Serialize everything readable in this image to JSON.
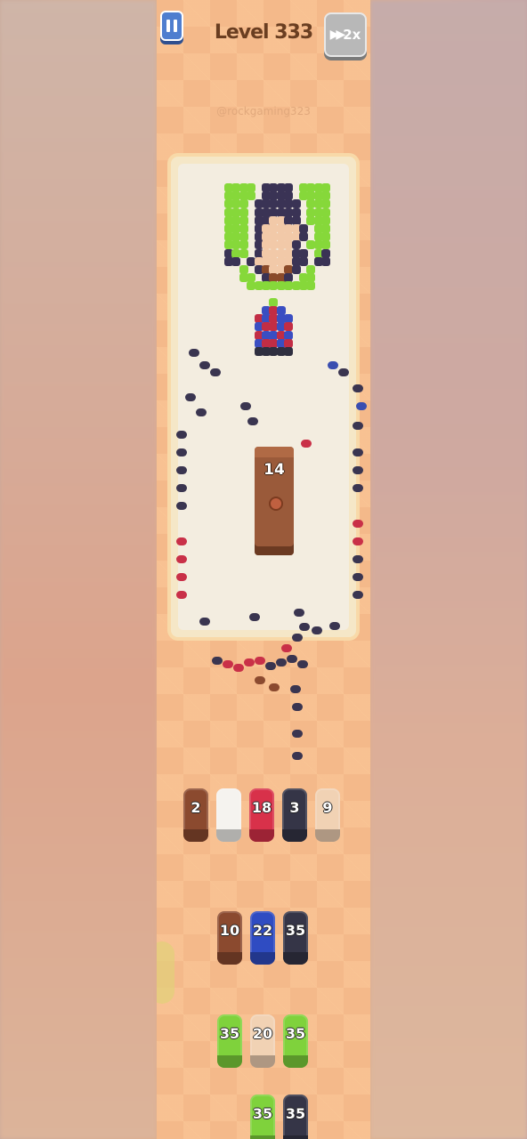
{
  "header": {
    "level": "Level 333",
    "speed": "2x"
  },
  "watermark": "@rockgaming323",
  "board": {
    "crate_count": "14"
  },
  "colors": {
    "brown": "#8b4a2f",
    "white": "#f5f3ef",
    "red": "#d8314a",
    "navy": "#353547",
    "peach": "#f1d2b4",
    "blue": "#2f4cc2",
    "green": "#7fd23c",
    "board": "#f3ede0"
  },
  "tray": [
    {
      "value": "2",
      "color": "brown"
    },
    {
      "value": "",
      "color": "white"
    },
    {
      "value": "18",
      "color": "red"
    },
    {
      "value": "3",
      "color": "navy"
    },
    {
      "value": "9",
      "color": "peach"
    }
  ],
  "queue": [
    [
      {
        "value": "10",
        "color": "brown"
      },
      {
        "value": "22",
        "color": "blue"
      },
      {
        "value": "35",
        "color": "navy"
      }
    ],
    [
      {
        "value": "35",
        "color": "green"
      },
      {
        "value": "20",
        "color": "peach"
      },
      {
        "value": "35",
        "color": "green"
      }
    ],
    [
      null,
      {
        "value": "35",
        "color": "green"
      },
      {
        "value": "35",
        "color": "navy"
      }
    ]
  ],
  "icons": {
    "pause": "pause-icon",
    "speed": "fast-forward-icon"
  }
}
